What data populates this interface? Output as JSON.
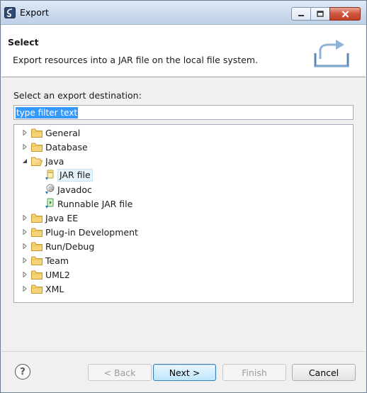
{
  "window": {
    "title": "Export"
  },
  "header": {
    "title": "Select",
    "description": "Export resources into a JAR file on the local file system."
  },
  "body": {
    "destination_label": "Select an export destination:",
    "filter": {
      "value": "type filter text"
    },
    "tree": [
      {
        "label": "General",
        "type": "folder",
        "expanded": false
      },
      {
        "label": "Database",
        "type": "folder",
        "expanded": false
      },
      {
        "label": "Java",
        "type": "folder",
        "expanded": true
      },
      {
        "label": "JAR file",
        "type": "jar-icon",
        "selected": true
      },
      {
        "label": "Javadoc",
        "type": "javadoc-icon"
      },
      {
        "label": "Runnable JAR file",
        "type": "runnable-jar-icon"
      },
      {
        "label": "Java EE",
        "type": "folder",
        "expanded": false
      },
      {
        "label": "Plug-in Development",
        "type": "folder",
        "expanded": false
      },
      {
        "label": "Run/Debug",
        "type": "folder",
        "expanded": false
      },
      {
        "label": "Team",
        "type": "folder",
        "expanded": false
      },
      {
        "label": "UML2",
        "type": "folder",
        "expanded": false
      },
      {
        "label": "XML",
        "type": "folder",
        "expanded": false
      }
    ]
  },
  "footer": {
    "help_glyph": "?",
    "back_label": "< Back",
    "next_label": "Next >",
    "finish_label": "Finish",
    "cancel_label": "Cancel"
  },
  "colors": {
    "selection": "#3399ff",
    "tree_selection": "#e5f3fb",
    "default_button_border": "#3c7fb1",
    "close_button": "#c23f28"
  }
}
